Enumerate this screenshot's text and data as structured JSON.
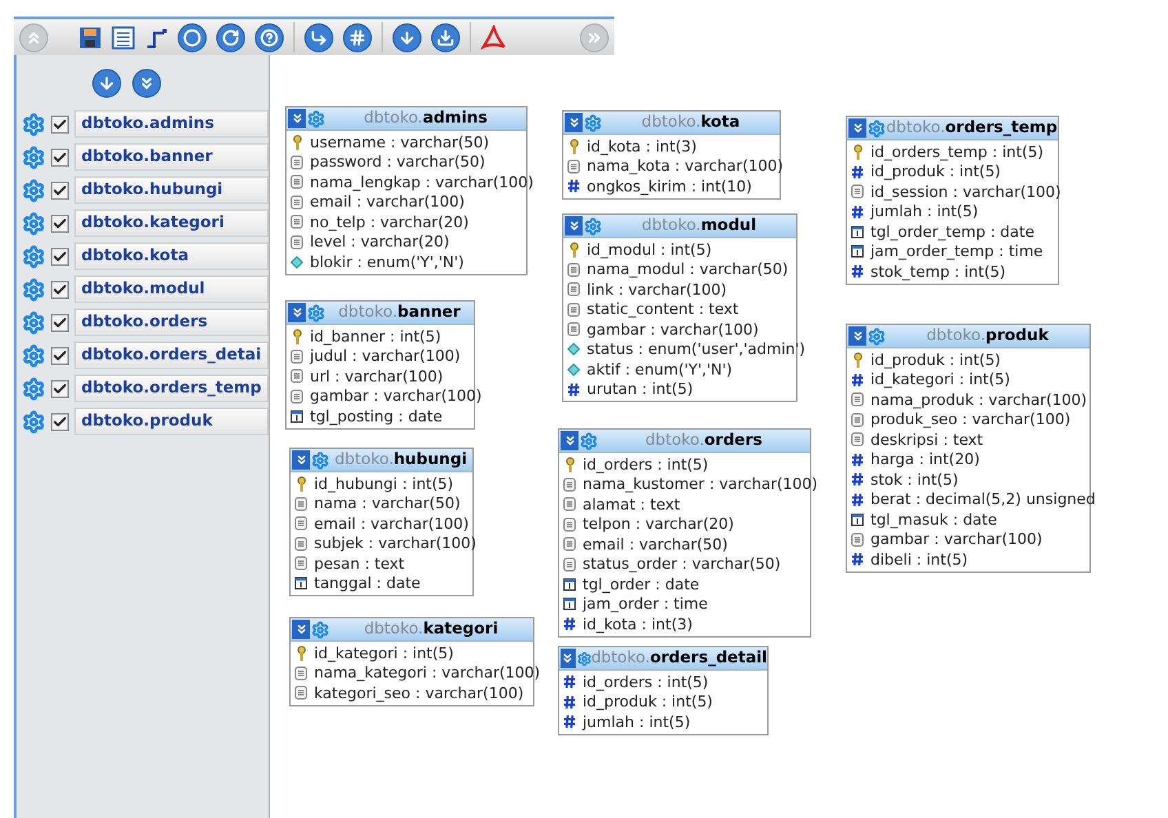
{
  "sidebar": {
    "items": [
      {
        "label": "dbtoko.admins",
        "checked": true
      },
      {
        "label": "dbtoko.banner",
        "checked": true
      },
      {
        "label": "dbtoko.hubungi",
        "checked": true
      },
      {
        "label": "dbtoko.kategori",
        "checked": true
      },
      {
        "label": "dbtoko.kota",
        "checked": true
      },
      {
        "label": "dbtoko.modul",
        "checked": true
      },
      {
        "label": "dbtoko.orders",
        "checked": true
      },
      {
        "label": "dbtoko.orders_detai",
        "checked": true
      },
      {
        "label": "dbtoko.orders_temp",
        "checked": true
      },
      {
        "label": "dbtoko.produk",
        "checked": true
      }
    ]
  },
  "tables": [
    {
      "db": "dbtoko.",
      "name": "admins",
      "fields": [
        {
          "kind": "key",
          "text": "username : varchar(50)"
        },
        {
          "kind": "text",
          "text": "password : varchar(50)"
        },
        {
          "kind": "text",
          "text": "nama_lengkap : varchar(100)"
        },
        {
          "kind": "text",
          "text": "email : varchar(100)"
        },
        {
          "kind": "text",
          "text": "no_telp : varchar(20)"
        },
        {
          "kind": "text",
          "text": "level : varchar(20)"
        },
        {
          "kind": "enum",
          "text": "blokir : enum('Y','N')"
        }
      ]
    },
    {
      "db": "dbtoko.",
      "name": "banner",
      "fields": [
        {
          "kind": "key",
          "text": "id_banner : int(5)"
        },
        {
          "kind": "text",
          "text": "judul : varchar(100)"
        },
        {
          "kind": "text",
          "text": "url : varchar(100)"
        },
        {
          "kind": "text",
          "text": "gambar : varchar(100)"
        },
        {
          "kind": "date",
          "text": "tgl_posting : date"
        }
      ]
    },
    {
      "db": "dbtoko.",
      "name": "hubungi",
      "fields": [
        {
          "kind": "key",
          "text": "id_hubungi : int(5)"
        },
        {
          "kind": "text",
          "text": "nama : varchar(50)"
        },
        {
          "kind": "text",
          "text": "email : varchar(100)"
        },
        {
          "kind": "text",
          "text": "subjek : varchar(100)"
        },
        {
          "kind": "text",
          "text": "pesan : text"
        },
        {
          "kind": "date",
          "text": "tanggal : date"
        }
      ]
    },
    {
      "db": "dbtoko.",
      "name": "kategori",
      "fields": [
        {
          "kind": "key",
          "text": "id_kategori : int(5)"
        },
        {
          "kind": "text",
          "text": "nama_kategori : varchar(100)"
        },
        {
          "kind": "text",
          "text": "kategori_seo : varchar(100)"
        }
      ]
    },
    {
      "db": "dbtoko.",
      "name": "kota",
      "fields": [
        {
          "kind": "key",
          "text": "id_kota : int(3)"
        },
        {
          "kind": "text",
          "text": "nama_kota : varchar(100)"
        },
        {
          "kind": "number",
          "text": "ongkos_kirim : int(10)"
        }
      ]
    },
    {
      "db": "dbtoko.",
      "name": "modul",
      "fields": [
        {
          "kind": "key",
          "text": "id_modul : int(5)"
        },
        {
          "kind": "text",
          "text": "nama_modul : varchar(50)"
        },
        {
          "kind": "text",
          "text": "link : varchar(100)"
        },
        {
          "kind": "text",
          "text": "static_content : text"
        },
        {
          "kind": "text",
          "text": "gambar : varchar(100)"
        },
        {
          "kind": "enum",
          "text": "status : enum('user','admin')"
        },
        {
          "kind": "enum",
          "text": "aktif : enum('Y','N')"
        },
        {
          "kind": "number",
          "text": "urutan : int(5)"
        }
      ]
    },
    {
      "db": "dbtoko.",
      "name": "orders",
      "fields": [
        {
          "kind": "key",
          "text": "id_orders : int(5)"
        },
        {
          "kind": "text",
          "text": "nama_kustomer : varchar(100)"
        },
        {
          "kind": "text",
          "text": "alamat : text"
        },
        {
          "kind": "text",
          "text": "telpon : varchar(20)"
        },
        {
          "kind": "text",
          "text": "email : varchar(50)"
        },
        {
          "kind": "text",
          "text": "status_order : varchar(50)"
        },
        {
          "kind": "date",
          "text": "tgl_order : date"
        },
        {
          "kind": "date",
          "text": "jam_order : time"
        },
        {
          "kind": "number",
          "text": "id_kota : int(3)"
        }
      ]
    },
    {
      "db": "dbtoko.",
      "name": "orders_detail",
      "fields": [
        {
          "kind": "number",
          "text": "id_orders : int(5)"
        },
        {
          "kind": "number",
          "text": "id_produk : int(5)"
        },
        {
          "kind": "number",
          "text": "jumlah : int(5)"
        }
      ]
    },
    {
      "db": "dbtoko.",
      "name": "orders_temp",
      "fields": [
        {
          "kind": "key",
          "text": "id_orders_temp : int(5)"
        },
        {
          "kind": "number",
          "text": "id_produk : int(5)"
        },
        {
          "kind": "text",
          "text": "id_session : varchar(100)"
        },
        {
          "kind": "number",
          "text": "jumlah : int(5)"
        },
        {
          "kind": "date",
          "text": "tgl_order_temp : date"
        },
        {
          "kind": "date",
          "text": "jam_order_temp : time"
        },
        {
          "kind": "number",
          "text": "stok_temp : int(5)"
        }
      ]
    },
    {
      "db": "dbtoko.",
      "name": "produk",
      "fields": [
        {
          "kind": "key",
          "text": "id_produk : int(5)"
        },
        {
          "kind": "number",
          "text": "id_kategori : int(5)"
        },
        {
          "kind": "text",
          "text": "nama_produk : varchar(100)"
        },
        {
          "kind": "text",
          "text": "produk_seo : varchar(100)"
        },
        {
          "kind": "text",
          "text": "deskripsi : text"
        },
        {
          "kind": "number",
          "text": "harga : int(20)"
        },
        {
          "kind": "number",
          "text": "stok : int(5)"
        },
        {
          "kind": "number",
          "text": "berat : decimal(5,2) unsigned"
        },
        {
          "kind": "date",
          "text": "tgl_masuk : date"
        },
        {
          "kind": "text",
          "text": "gambar : varchar(100)"
        },
        {
          "kind": "number",
          "text": "dibeli : int(5)"
        }
      ]
    }
  ]
}
